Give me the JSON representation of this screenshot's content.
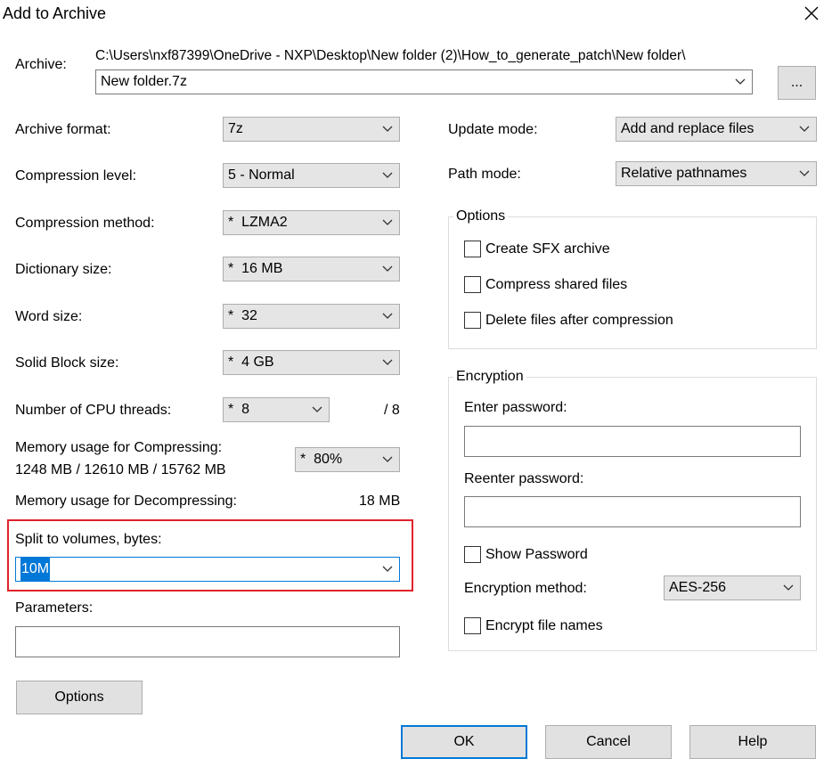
{
  "window": {
    "title": "Add to Archive"
  },
  "icons": {
    "close": "close-icon",
    "chevron": "chevron-down-icon"
  },
  "archive": {
    "label": "Archive:",
    "path": "C:\\Users\\nxf87399\\OneDrive - NXP\\Desktop\\New folder (2)\\How_to_generate_patch\\New folder\\",
    "filename": "New folder.7z",
    "browse_label": "..."
  },
  "left": {
    "archive_format": {
      "label": "Archive format:",
      "value": "7z"
    },
    "compression_level": {
      "label": "Compression level:",
      "value": "5 - Normal"
    },
    "compression_method": {
      "label": "Compression method:",
      "value": "*  LZMA2"
    },
    "dictionary_size": {
      "label": "Dictionary size:",
      "value": "*  16 MB"
    },
    "word_size": {
      "label": "Word size:",
      "value": "*  32"
    },
    "solid_block_size": {
      "label": "Solid Block size:",
      "value": "*  4 GB"
    },
    "cpu_threads": {
      "label": "Number of CPU threads:",
      "value": "*  8",
      "max": "/ 8"
    },
    "memory_compress": {
      "label": "Memory usage for Compressing:",
      "detail": "1248 MB / 12610 MB / 15762 MB",
      "value": "*  80%"
    },
    "memory_decompress": {
      "label": "Memory usage for Decompressing:",
      "value": "18 MB"
    },
    "split_volumes": {
      "label": "Split to volumes, bytes:",
      "value": "10M"
    },
    "parameters": {
      "label": "Parameters:",
      "value": ""
    },
    "options_button": "Options"
  },
  "right": {
    "update_mode": {
      "label": "Update mode:",
      "value": "Add and replace files"
    },
    "path_mode": {
      "label": "Path mode:",
      "value": "Relative pathnames"
    },
    "options_group": {
      "title": "Options",
      "create_sfx": "Create SFX archive",
      "compress_shared": "Compress shared files",
      "delete_after": "Delete files after compression"
    },
    "encryption_group": {
      "title": "Encryption",
      "enter_password": "Enter password:",
      "reenter_password": "Reenter password:",
      "show_password": "Show Password",
      "method_label": "Encryption method:",
      "method_value": "AES-256",
      "encrypt_names": "Encrypt file names"
    }
  },
  "buttons": {
    "ok": "OK",
    "cancel": "Cancel",
    "help": "Help"
  },
  "colors": {
    "highlight_border": "#e0212b",
    "selection": "#0078d7",
    "default_button": "#0078d7"
  }
}
